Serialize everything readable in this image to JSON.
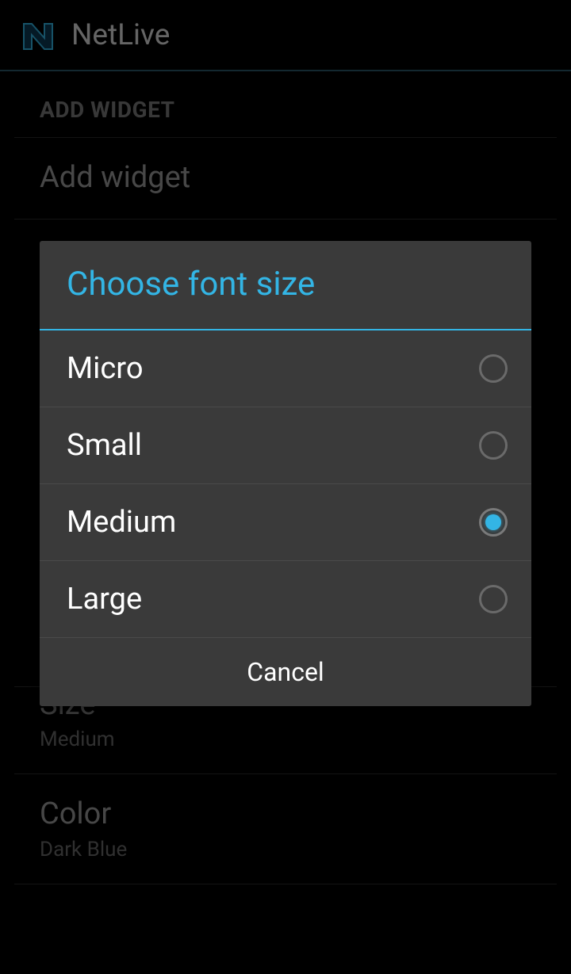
{
  "header": {
    "app_name": "NetLive"
  },
  "settings": {
    "section_header": "ADD WIDGET",
    "rows": [
      {
        "title": "Add widget"
      },
      {
        "title": "Size",
        "sub": "Medium"
      },
      {
        "title": "Color",
        "sub": "Dark Blue"
      }
    ]
  },
  "dialog": {
    "title": "Choose font size",
    "options": [
      {
        "label": "Micro",
        "selected": false
      },
      {
        "label": "Small",
        "selected": false
      },
      {
        "label": "Medium",
        "selected": true
      },
      {
        "label": "Large",
        "selected": false
      }
    ],
    "cancel_label": "Cancel"
  }
}
